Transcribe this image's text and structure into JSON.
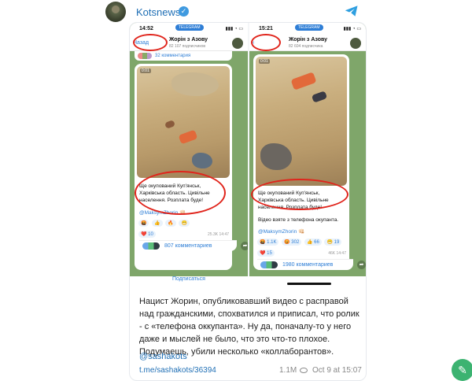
{
  "channel": {
    "name": "Kotsnews",
    "verified_icon": "verified-check-icon",
    "logo_icon": "telegram-plane-icon"
  },
  "left_phone": {
    "time": "14:52",
    "pill": "TELEGRAM",
    "back": "Назад",
    "chat_title": "Жорін з Азову",
    "subscribers": "82 107 подписчиков",
    "top_comments": "32 комментария",
    "video_duration": "0:01",
    "message_lines": [
      "Ще окупований Куп'янськ,",
      "Харківська область. Цивільне",
      "населення. Розплата буде!"
    ],
    "handle": "@MaksymZhorin 👊🏻",
    "reactions_row1": [
      "🤬",
      "👍",
      "🔥",
      "😁"
    ],
    "reactions_row2": [
      "❤️ 10"
    ],
    "time_stamp": "25.3K 14:47",
    "comments": "807 комментариев",
    "subscribe": "Подписаться"
  },
  "right_phone": {
    "time": "15:21",
    "pill": "TELEGRAM",
    "chat_title": "Жорін з Азову",
    "subscribers": "82 604 подписчика",
    "video_duration": "0:01",
    "message_lines": [
      "Ще окупований Куп'янськ,",
      "Харківська область. Цивільне",
      "населення. Розплата буде!"
    ],
    "message_extra": "Відео взяте з телефона окупанта.",
    "handle": "@MaksymZhorin 👊🏻",
    "reactions_row1": [
      "🤬 1.1K",
      "😡 302",
      "👍 66",
      "😁 19"
    ],
    "reactions_row2": [
      "❤️ 15"
    ],
    "time_stamp": "46K 14:47",
    "comments": "1980 комментариев"
  },
  "caption": "Нацист Жорин, опубликовавший видео с расправой над гражданскими, спохватился и приписал, что ролик - с «телефона оккупанта». Ну да, поначалу-то у него даже и мыслей не было, что это что-то плохое. Подумаешь, убили несколько «коллаборантов».",
  "author": "@sashakots",
  "post_link": "t.me/sashakots/36394",
  "views": "1.1M",
  "date": "Oct 9 at 15:07",
  "annotation_color": "#e0241b",
  "accent_color": "#2e7ed6"
}
